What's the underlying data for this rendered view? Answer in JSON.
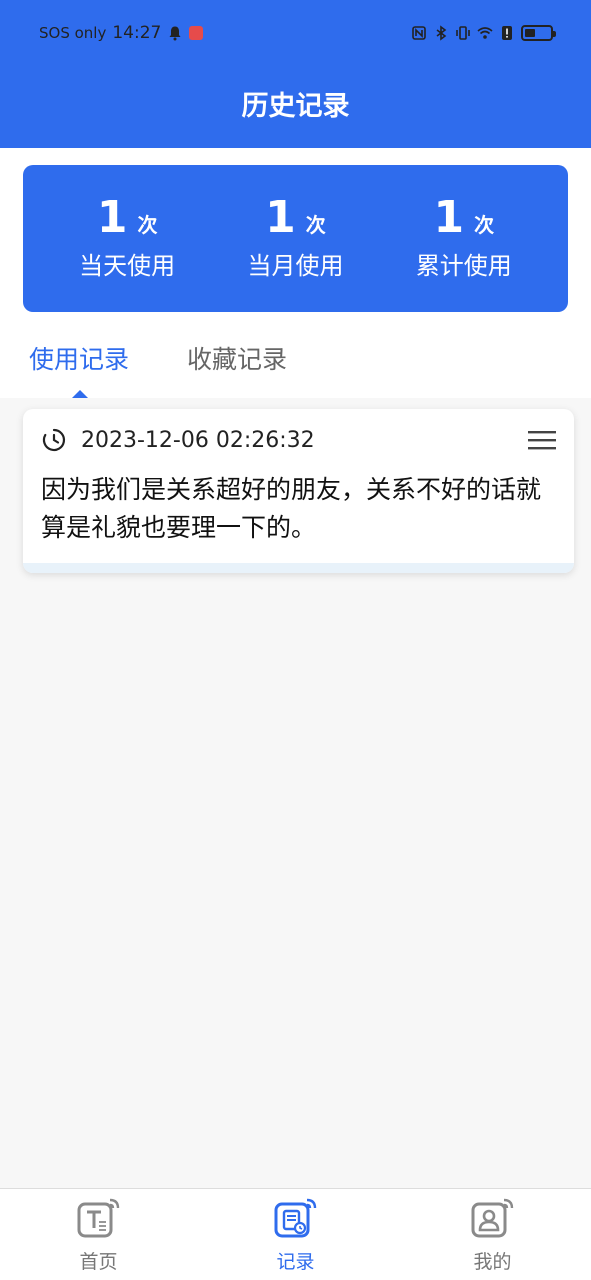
{
  "status_bar": {
    "carrier": "SOS only",
    "time": "14:27"
  },
  "header": {
    "title": "历史记录"
  },
  "stats": [
    {
      "value": "1",
      "unit": "次",
      "label": "当天使用"
    },
    {
      "value": "1",
      "unit": "次",
      "label": "当月使用"
    },
    {
      "value": "1",
      "unit": "次",
      "label": "累计使用"
    }
  ],
  "tabs": [
    {
      "label": "使用记录",
      "active": true
    },
    {
      "label": "收藏记录",
      "active": false
    }
  ],
  "records": [
    {
      "time": "2023-12-06 02:26:32",
      "text": "因为我们是关系超好的朋友，关系不好的话就算是礼貌也要理一下的。"
    }
  ],
  "bottom_nav": [
    {
      "label": "首页",
      "icon": "text-tool-icon",
      "active": false
    },
    {
      "label": "记录",
      "icon": "record-icon",
      "active": true
    },
    {
      "label": "我的",
      "icon": "profile-icon",
      "active": false
    }
  ],
  "colors": {
    "primary": "#2f6ced",
    "background": "#f7f7f7"
  }
}
